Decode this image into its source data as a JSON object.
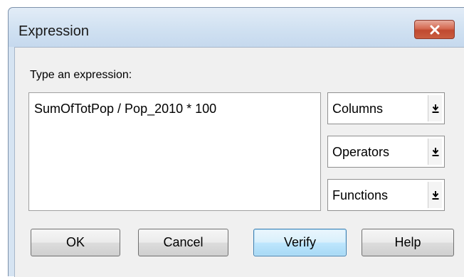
{
  "window": {
    "title": "Expression"
  },
  "icons": {
    "close": "close-icon",
    "dropdown": "down-arrow-underline-icon"
  },
  "colors": {
    "title_bar": "#cfe0f1",
    "close_button": "#c95d40",
    "client_background": "#f0f0f0",
    "default_button_border": "#3c7fb1"
  },
  "prompt": {
    "label": "Type an expression:"
  },
  "expression": {
    "value": "SumOfTotPop / Pop_2010 * 100"
  },
  "dropdowns": [
    {
      "label": "Columns"
    },
    {
      "label": "Operators"
    },
    {
      "label": "Functions"
    }
  ],
  "buttons": {
    "ok": "OK",
    "cancel": "Cancel",
    "verify": "Verify",
    "help": "Help"
  }
}
